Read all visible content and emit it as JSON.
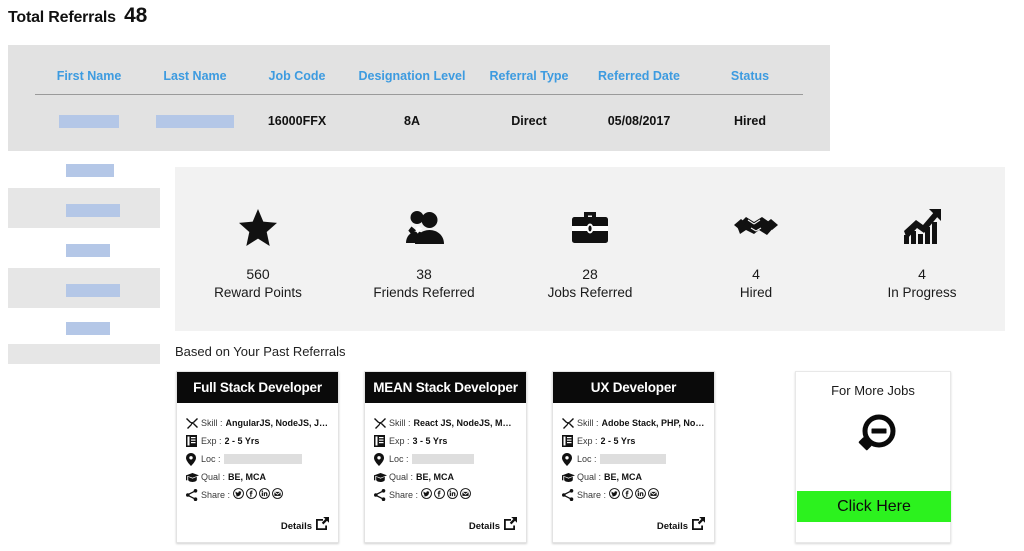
{
  "page": {
    "title_label": "Total Referrals",
    "title_count": "48"
  },
  "referrals_table": {
    "columns": [
      "First Name",
      "Last Name",
      "Job Code",
      "Designation Level",
      "Referral Type",
      "Referred Date",
      "Status"
    ],
    "rows": [
      {
        "first_name": "",
        "last_name": "",
        "job_code": "16000FFX",
        "designation_level": "8A",
        "referral_type": "Direct",
        "referred_date": "05/08/2017",
        "status": "Hired"
      }
    ],
    "header_link_color": "#3d9be0",
    "band_color": "#e2e2e2",
    "redaction_color": "#b4c7e7"
  },
  "sidebar_skeleton": {
    "band_color": "#e6e6e6",
    "bar_color": "#b4c7e7",
    "items": [
      {
        "bar": true,
        "band": false
      },
      {
        "bar": true,
        "band": true
      },
      {
        "bar": true,
        "band": false
      },
      {
        "bar": true,
        "band": true
      },
      {
        "bar": true,
        "band": false
      },
      {
        "bar": false,
        "band": true
      }
    ]
  },
  "stats": {
    "band_color": "#f2f2f2",
    "items": [
      {
        "icon": "star-icon",
        "value": "560",
        "label": "Reward Points"
      },
      {
        "icon": "people-icon",
        "value": "38",
        "label": "Friends Referred"
      },
      {
        "icon": "briefcase-icon",
        "value": "28",
        "label": "Jobs Referred"
      },
      {
        "icon": "handshake-icon",
        "value": "4",
        "label": "Hired"
      },
      {
        "icon": "growth-chart-icon",
        "value": "4",
        "label": "In Progress"
      }
    ]
  },
  "jobs_section": {
    "caption": "Based on Your Past Referrals",
    "field_labels": {
      "skill": "Skill :",
      "exp": "Exp :",
      "loc": "Loc :",
      "qual": "Qual :",
      "share": "Share :"
    },
    "details_label": "Details",
    "social_icons": [
      "twitter-icon",
      "facebook-icon",
      "linkedin-icon",
      "email-icon"
    ],
    "cards": [
      {
        "title": "Full Stack Developer",
        "skill": "AngularJS, NodeJS, Java...",
        "exp": "2 - 5 Yrs",
        "loc": "",
        "qual": "BE, MCA"
      },
      {
        "title": "MEAN Stack Developer",
        "skill": "React JS, NodeJS, Mongo...",
        "exp": "3 - 5 Yrs",
        "loc": "",
        "qual": "BE, MCA"
      },
      {
        "title": "UX Developer",
        "skill": "Adobe Stack, PHP, NodeJS...",
        "exp": "2 - 5 Yrs",
        "loc": "",
        "qual": "BE, MCA"
      }
    ]
  },
  "more_jobs": {
    "title": "For More Jobs",
    "icon": "magnifier-minus-icon",
    "button_label": "Click Here",
    "button_color": "#2cf21e"
  }
}
